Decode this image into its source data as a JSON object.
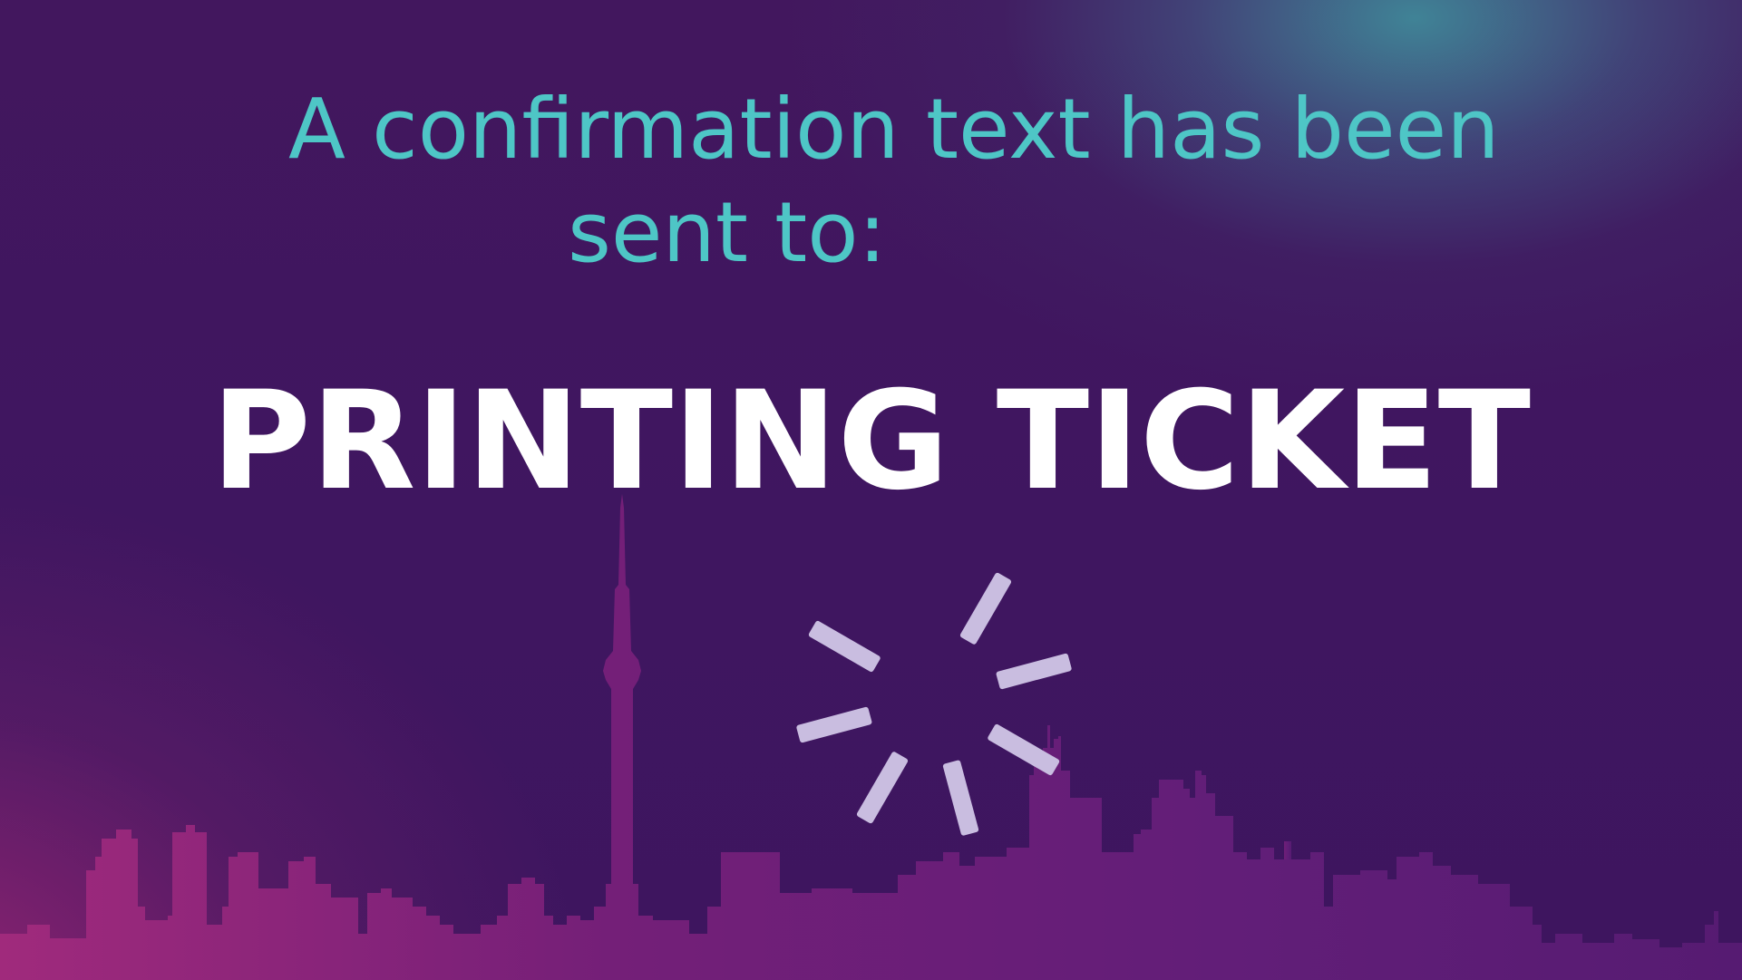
{
  "screen": {
    "heading_line1": "A confirmation text has been",
    "heading_line2": "sent to:",
    "status_title": "PRINTING TICKET"
  },
  "loading_indicator": {
    "icon": "loading-spinner-icon",
    "color": "#c9bde0"
  },
  "skyline": {
    "icon": "city-skyline-silhouette",
    "color_left": "#9a2a7a",
    "color_right": "#5e1f78"
  },
  "colors": {
    "background": "#3e1760",
    "accent_teal": "#4ec6c6",
    "title_white": "#ffffff"
  }
}
